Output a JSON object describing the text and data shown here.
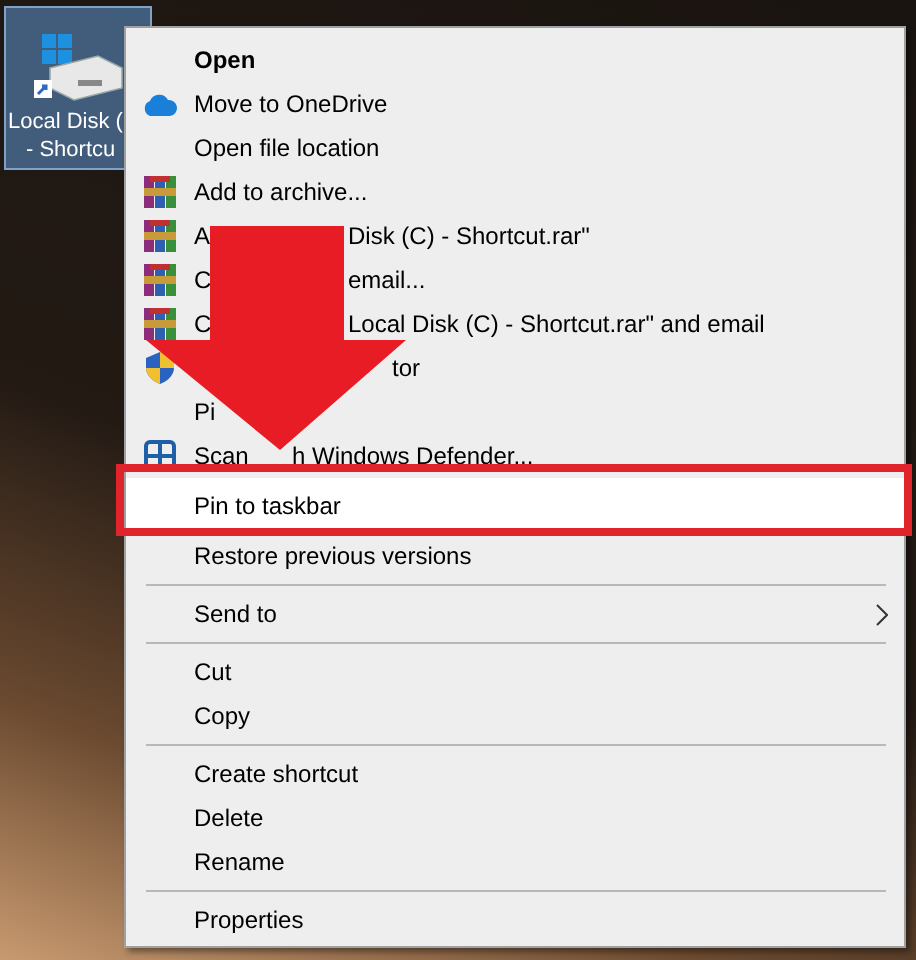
{
  "desktop_icon": {
    "label_lines": [
      "Local Disk (",
      "- Shortcu"
    ],
    "selected": true
  },
  "context_menu": {
    "items": [
      {
        "kind": "plain",
        "text": "Open",
        "bold": true,
        "highlighted": false
      },
      {
        "kind": "cloud",
        "text": "Move to OneDrive",
        "bold": false,
        "highlighted": false
      },
      {
        "kind": "plain",
        "text": "Open file location",
        "bold": false,
        "highlighted": false
      },
      {
        "kind": "archive",
        "text": "Add to archive...",
        "bold": false,
        "highlighted": false
      },
      {
        "kind": "archive",
        "text": "A",
        "text_after": "Disk (C) - Shortcut.rar\"",
        "bold": false,
        "highlighted": false
      },
      {
        "kind": "archive",
        "text": "C",
        "text_after": "email...",
        "bold": false,
        "highlighted": false
      },
      {
        "kind": "archive",
        "text": "C",
        "text_after": "Local Disk (C) - Shortcut.rar\" and email",
        "bold": false,
        "highlighted": false
      },
      {
        "kind": "shield",
        "text_after": "tor",
        "bold": false,
        "highlighted": false
      },
      {
        "kind": "plain",
        "text": "Pi",
        "bold": false,
        "highlighted": false
      },
      {
        "kind": "defender",
        "text": "Scan",
        "text_after": "h Windows Defender...",
        "bold": false,
        "highlighted": false
      },
      {
        "kind": "plain",
        "text": "Pin to taskbar",
        "bold": false,
        "highlighted": true
      },
      {
        "kind": "plain",
        "text": "Restore previous versions",
        "bold": false,
        "highlighted": false
      },
      {
        "kind": "separator"
      },
      {
        "kind": "submenu",
        "text": "Send to",
        "bold": false,
        "highlighted": false
      },
      {
        "kind": "separator"
      },
      {
        "kind": "plain",
        "text": "Cut",
        "bold": false,
        "highlighted": false
      },
      {
        "kind": "plain",
        "text": "Copy",
        "bold": false,
        "highlighted": false
      },
      {
        "kind": "separator"
      },
      {
        "kind": "plain",
        "text": "Create shortcut",
        "bold": false,
        "highlighted": false
      },
      {
        "kind": "plain",
        "text": "Delete",
        "bold": false,
        "highlighted": false
      },
      {
        "kind": "plain",
        "text": "Rename",
        "bold": false,
        "highlighted": false
      },
      {
        "kind": "separator"
      },
      {
        "kind": "plain",
        "text": "Properties",
        "bold": false,
        "highlighted": false
      }
    ]
  }
}
